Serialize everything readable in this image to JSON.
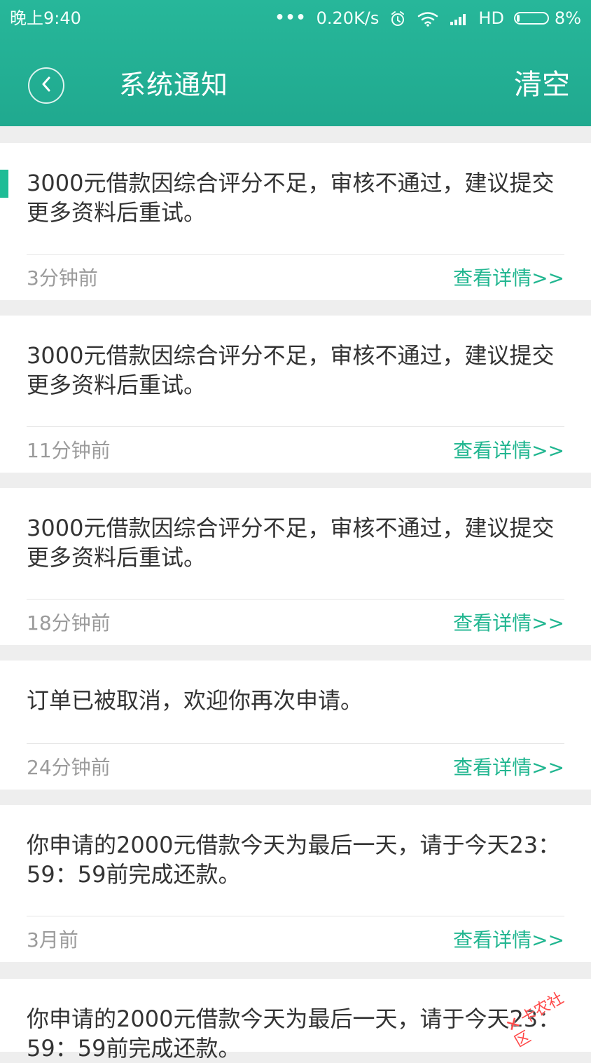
{
  "status_bar": {
    "time": "晚上9:40",
    "dots": "•••",
    "network_speed": "0.20K/s",
    "network_type": "HD",
    "battery_percent": "8%"
  },
  "header": {
    "title": "系统通知",
    "clear_label": "清空"
  },
  "notifications": [
    {
      "message": "3000元借款因综合评分不足，审核不通过，建议提交更多资料后重试。",
      "time": "3分钟前",
      "link": "查看详情>>"
    },
    {
      "message": "3000元借款因综合评分不足，审核不通过，建议提交更多资料后重试。",
      "time": "11分钟前",
      "link": "查看详情>>"
    },
    {
      "message": "3000元借款因综合评分不足，审核不通过，建议提交更多资料后重试。",
      "time": "18分钟前",
      "link": "查看详情>>"
    },
    {
      "message": "订单已被取消，欢迎你再次申请。",
      "time": "24分钟前",
      "link": "查看详情>>"
    },
    {
      "message": "你申请的2000元借款今天为最后一天，请于今天23：59：59前完成还款。",
      "time": "3月前",
      "link": "查看详情>>"
    },
    {
      "message": "你申请的2000元借款今天为最后一天，请于今天23：59：59前完成还款。",
      "time": "",
      "link": ""
    }
  ],
  "watermark": {
    "text": "卡农社区"
  },
  "colors": {
    "header": "#20a98f",
    "accent": "#1fbc96",
    "link": "#21b690"
  }
}
